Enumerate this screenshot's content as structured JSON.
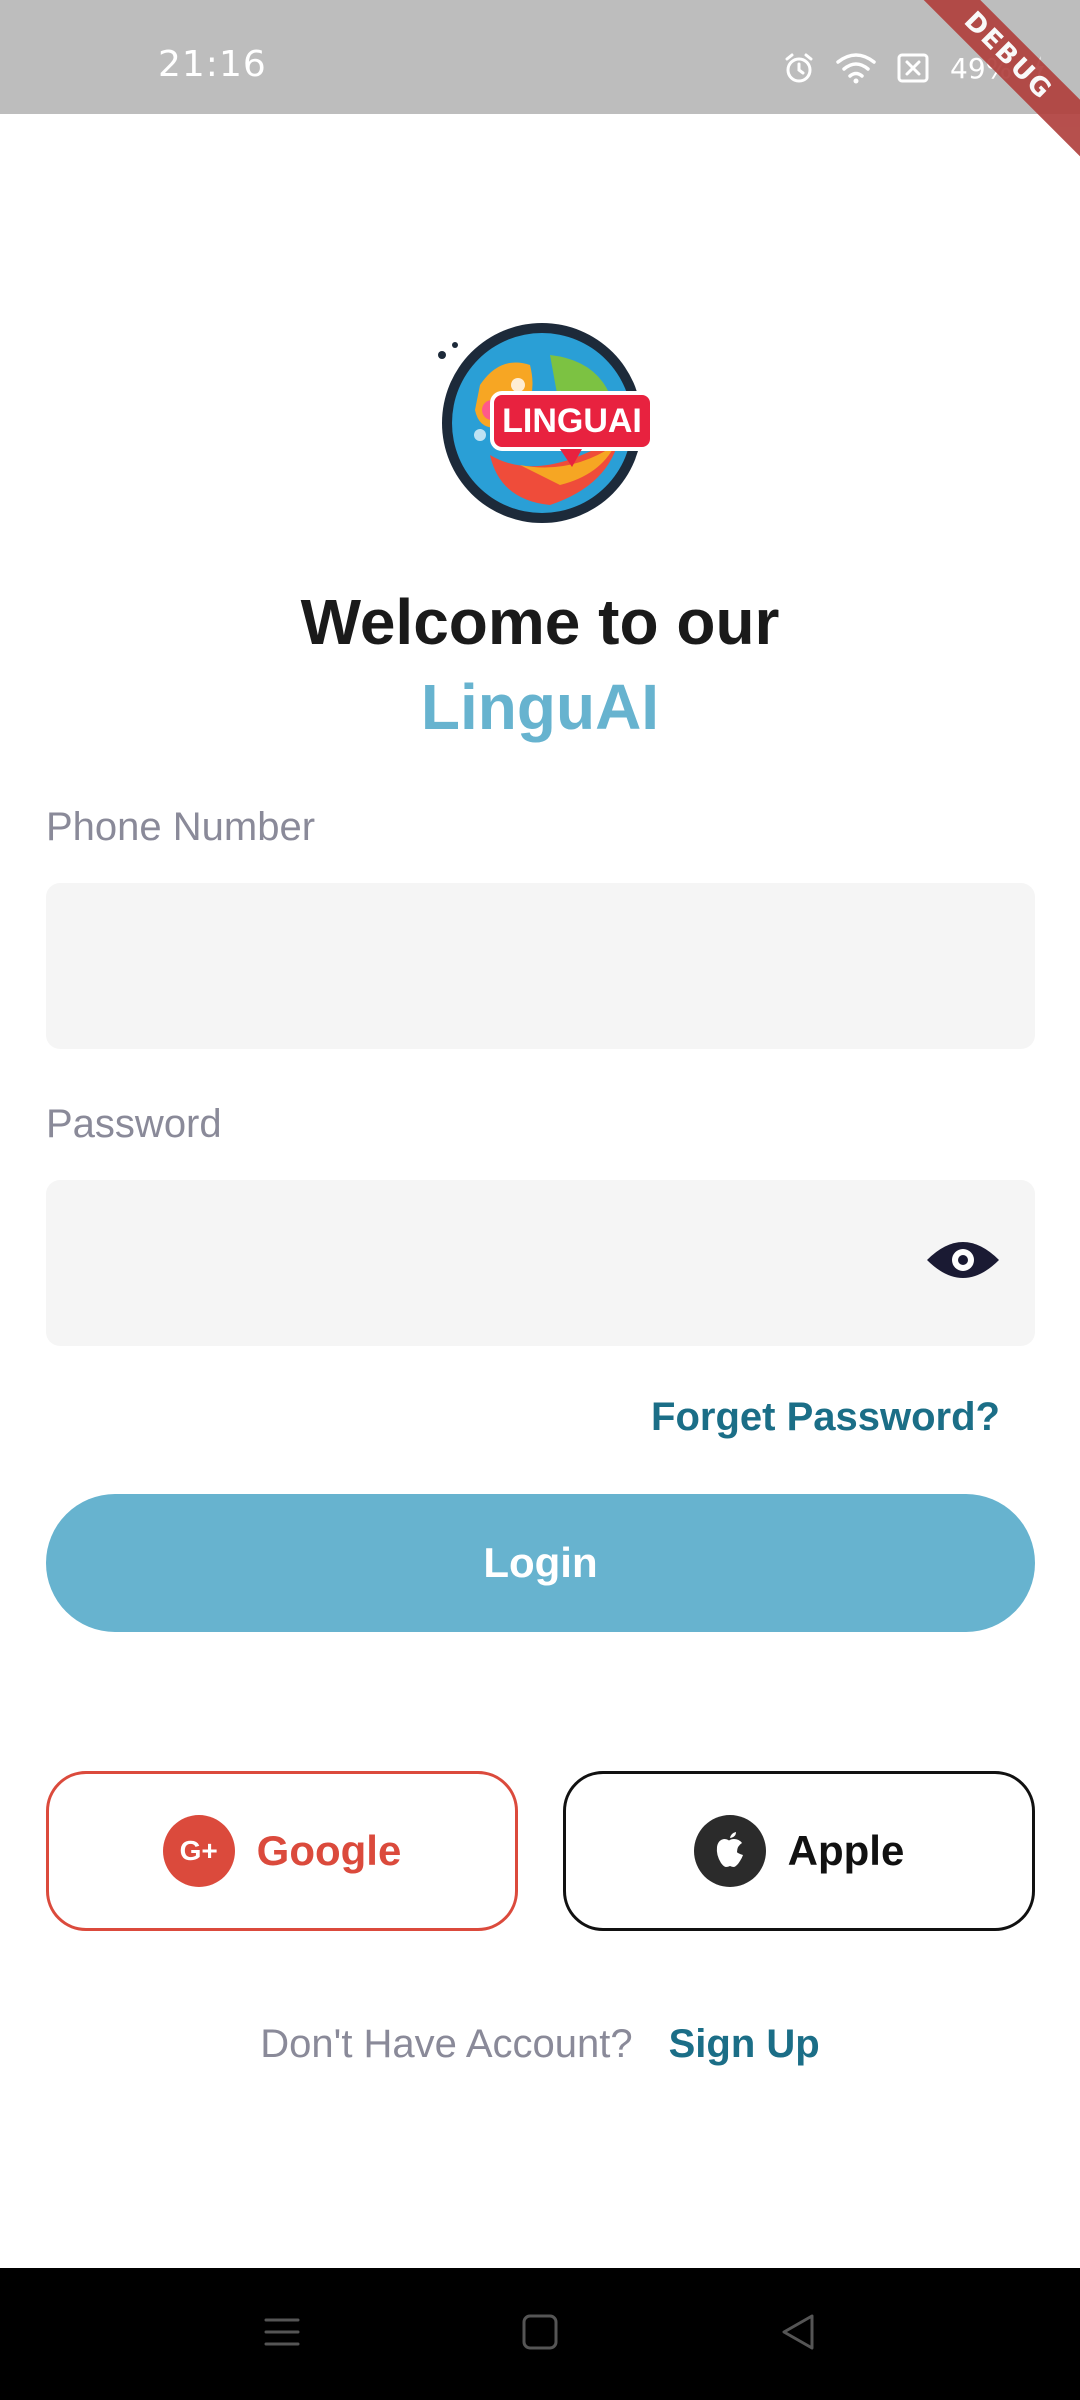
{
  "status_bar": {
    "time": "21:16",
    "battery": "49%",
    "icons": [
      "alarm-icon",
      "wifi-icon",
      "sim-off-icon",
      "battery-charging-icon"
    ]
  },
  "debug_banner": "DEBUG",
  "logo": {
    "text": "LINGUAI",
    "icon": "linguai-logo"
  },
  "header": {
    "welcome": "Welcome to our",
    "brand": "LinguAI"
  },
  "form": {
    "phone_label": "Phone Number",
    "phone_value": "",
    "phone_placeholder": "",
    "password_label": "Password",
    "password_value": "",
    "password_placeholder": "",
    "forget_password": "Forget Password?",
    "login_button": "Login"
  },
  "social": {
    "google_label": "Google",
    "google_icon_text": "G+",
    "apple_label": "Apple"
  },
  "signup": {
    "prompt": "Don't Have Account?",
    "link": "Sign Up"
  },
  "nav": {
    "icons": [
      "menu-icon",
      "home-square-icon",
      "back-triangle-icon"
    ]
  },
  "colors": {
    "accent": "#67b3cf",
    "link": "#1b6e87",
    "google": "#db4a3c",
    "field_bg": "#f5f5f5"
  }
}
